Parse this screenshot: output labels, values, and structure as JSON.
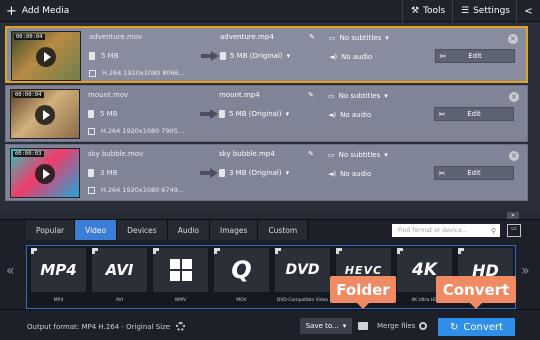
{
  "toolbar": {
    "add_media_label": "Add Media",
    "tools_label": "Tools",
    "settings_label": "Settings"
  },
  "files": [
    {
      "time": "00:00:04",
      "source_name": "adventure.mov",
      "source_size": "5 MB",
      "source_info": "H.264 1920x1080 8066...",
      "output_name": "adventure.mp4",
      "output_size": "5 MB (Original)",
      "subtitles": "No subtitles",
      "audio": "No audio",
      "edit_label": "Edit",
      "thumb_colors": [
        "#3c4a2a",
        "#b98a45",
        "#6e7f4a"
      ]
    },
    {
      "time": "00:00:04",
      "source_name": "mount.mov",
      "source_size": "5 MB",
      "source_info": "H.264 1920x1080 7905...",
      "output_name": "mount.mp4",
      "output_size": "5 MB (Original)",
      "subtitles": "No subtitles",
      "audio": "No audio",
      "edit_label": "Edit",
      "thumb_colors": [
        "#5b3f2c",
        "#d2b07a",
        "#8a6a4a"
      ]
    },
    {
      "time": "00:00:03",
      "source_name": "sky bubble.mov",
      "source_size": "3 MB",
      "source_info": "H.264 1920x1080 6749...",
      "output_name": "sky bubble.mp4",
      "output_size": "3 MB (Original)",
      "subtitles": "No subtitles",
      "audio": "No audio",
      "edit_label": "Edit",
      "thumb_colors": [
        "#2ec4b6",
        "#f03b6a",
        "#22a7d8"
      ]
    }
  ],
  "format_tabs": [
    "Popular",
    "Video",
    "Devices",
    "Audio",
    "Images",
    "Custom"
  ],
  "active_tab": "Video",
  "search_placeholder": "Find format or device...",
  "formats": [
    {
      "logo": "MP4",
      "caption": "MP4"
    },
    {
      "logo": "AVI",
      "caption": "AVI"
    },
    {
      "logo": "",
      "caption": "WMV"
    },
    {
      "logo": "Q",
      "caption": "MOV"
    },
    {
      "logo": "DVD",
      "caption": "DVD-Compatible Video"
    },
    {
      "logo": "HEVC",
      "caption": ""
    },
    {
      "logo": "4K",
      "caption": "4K Ultra HD"
    },
    {
      "logo": "HD",
      "caption": ""
    }
  ],
  "bottom": {
    "output_format": "Output format: MP4 H.264 - Original Size",
    "save_to": "Save to...",
    "merge_files": "Merge files",
    "convert": "Convert"
  },
  "callouts": {
    "folder": "Folder",
    "convert": "Convert"
  },
  "colors": {
    "accent": "#3a7ed8",
    "selected_border": "#e6a21c",
    "callout": "#f08a62",
    "convert_button": "#2f8ee8"
  }
}
